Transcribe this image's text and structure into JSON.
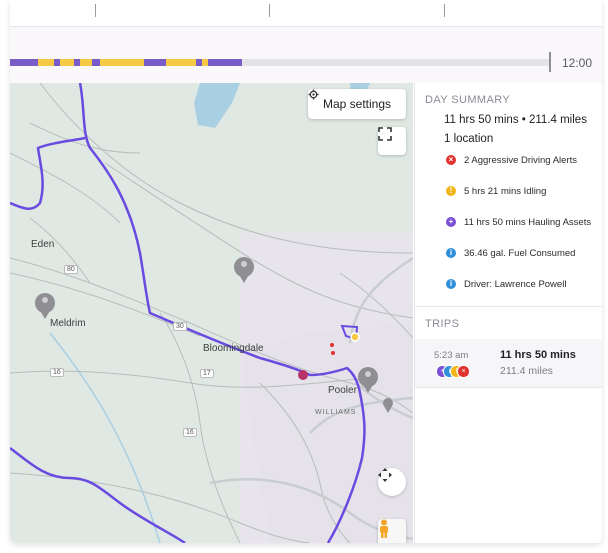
{
  "timeline": {
    "end_time": "12:00"
  },
  "map": {
    "settings_label": "Map settings",
    "places": {
      "eden": "Eden",
      "meldrim": "Meldrim",
      "bloomingdale": "Bloomingdale",
      "pooler": "Pooler",
      "williams": "WILLIAMS"
    },
    "road_shields": {
      "r80": "80",
      "r17": "17",
      "r16": "16",
      "r16b": "16",
      "r30": "30"
    }
  },
  "summary": {
    "title": "DAY SUMMARY",
    "duration_distance": "11 hrs 50 mins • 211.4 miles",
    "locations": "1 location",
    "alerts": [
      {
        "icon": "error-icon",
        "color": "#e0322e",
        "text": "2 Aggressive Driving Alerts"
      },
      {
        "icon": "warning-icon",
        "color": "#f2b51a",
        "text": "5 hrs 21 mins Idling"
      },
      {
        "icon": "plus-circle-icon",
        "color": "#7b4fd6",
        "text": "11 hrs 50 mins Hauling Assets"
      },
      {
        "icon": "info-icon",
        "color": "#2f8fd8",
        "text": "36.46 gal. Fuel Consumed"
      },
      {
        "icon": "info-icon",
        "color": "#2f8fd8",
        "text": "Driver: Lawrence Powell"
      }
    ]
  },
  "trips": {
    "title": "TRIPS",
    "items": [
      {
        "start": "5:23 am",
        "duration": "11 hrs 50 mins",
        "distance": "211.4 miles"
      }
    ]
  },
  "colors": {
    "route": "#6a4be0",
    "timeline_purple": "#7a5cc8",
    "timeline_yellow": "#f6c945",
    "map_water": "#a9cfe3"
  }
}
